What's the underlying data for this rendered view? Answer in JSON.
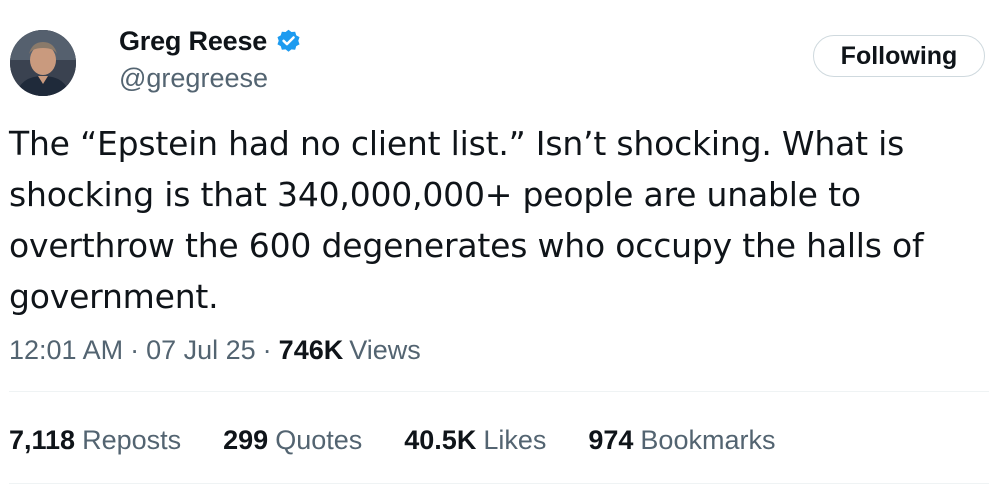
{
  "author": {
    "display_name": "Greg Reese",
    "handle": "@gregreese",
    "verified_icon": "verified-badge-icon",
    "verified_color": "#1d9bf0"
  },
  "follow_button": {
    "label": "Following"
  },
  "tweet": {
    "text": "The “Epstein had no client list.” Isn’t shocking. What is shocking is that 340,000,000+ people are unable to overthrow the 600 degenerates who occupy the halls of government."
  },
  "meta": {
    "time": "12:01 AM",
    "separator": "·",
    "date": "07 Jul 25",
    "views_count": "746K",
    "views_label": "Views"
  },
  "stats": {
    "reposts": {
      "count": "7,118",
      "label": "Reposts"
    },
    "quotes": {
      "count": "299",
      "label": "Quotes"
    },
    "likes": {
      "count": "40.5K",
      "label": "Likes"
    },
    "bookmarks": {
      "count": "974",
      "label": "Bookmarks"
    }
  },
  "colors": {
    "text_primary": "#0f1419",
    "text_secondary": "#536471",
    "divider": "#eff3f4",
    "accent": "#1d9bf0"
  }
}
